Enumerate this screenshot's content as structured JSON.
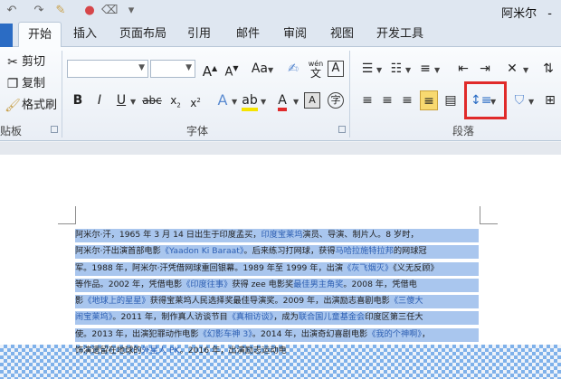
{
  "titlebar": {
    "owner": "阿米尔",
    "minimize": "-"
  },
  "tabs": [
    {
      "label": "开始",
      "active": true
    },
    {
      "label": "插入"
    },
    {
      "label": "页面布局"
    },
    {
      "label": "引用"
    },
    {
      "label": "邮件"
    },
    {
      "label": "审阅"
    },
    {
      "label": "视图"
    },
    {
      "label": "开发工具"
    }
  ],
  "clipboard": {
    "cut": "剪切",
    "copy": "复制",
    "format_painter": "格式刷",
    "group_label": "贴板"
  },
  "font": {
    "font_name": "",
    "font_size": "",
    "group_label": "字体",
    "pinyin_label": "wén"
  },
  "paragraph": {
    "group_label": "段落"
  },
  "document": {
    "lines": [
      {
        "segments": [
          {
            "t": "阿米尔·汗，1965 年 3 月 14 日出生于印度孟买，"
          },
          {
            "t": "印度宝莱坞",
            "link": true
          },
          {
            "t": "演员、导演、制片人。8 岁时，"
          }
        ]
      },
      {
        "segments": [
          {
            "t": "阿米尔·汗出演首部电影"
          },
          {
            "t": "《Yaadon Ki Baraat》",
            "link": true
          },
          {
            "t": "。后来练习打网球，获得"
          },
          {
            "t": "马哈拉施特拉邦",
            "link": true
          },
          {
            "t": "的网球冠"
          }
        ]
      },
      {
        "segments": [
          {
            "t": "军。1988 年，阿米尔·汗凭借网球重回银幕。1989 年至 1999 年，出演"
          },
          {
            "t": "《灰飞烟灭》",
            "link": true
          },
          {
            "t": "《义无反顾》"
          }
        ]
      },
      {
        "segments": [
          {
            "t": "等作品。2002 年，凭借电影"
          },
          {
            "t": "《印度往事》",
            "link": true
          },
          {
            "t": "获得 zee 电影奖"
          },
          {
            "t": "最佳男主角奖",
            "link": true
          },
          {
            "t": "。2008 年，凭借电"
          }
        ]
      },
      {
        "segments": [
          {
            "t": "影"
          },
          {
            "t": "《地球上的星星》",
            "link": true
          },
          {
            "t": "获得宝莱坞人民选择奖最佳导演奖。2009 年，出演励志喜剧电影"
          },
          {
            "t": "《三傻大",
            "link": true
          }
        ]
      },
      {
        "segments": [
          {
            "t": "闹宝莱坞》",
            "link": true
          },
          {
            "t": "。2011 年，制作真人访谈节目"
          },
          {
            "t": "《真相访谈》",
            "link": true
          },
          {
            "t": "，成为"
          },
          {
            "t": "联合国儿童基金会",
            "link": true
          },
          {
            "t": "印度区第三任大"
          }
        ]
      },
      {
        "segments": [
          {
            "t": "使。2013 年，出演犯罪动作电影"
          },
          {
            "t": "《幻影车神 3》",
            "link": true
          },
          {
            "t": "。2014 年，出演奇幻喜剧电影"
          },
          {
            "t": "《我的个神啊》",
            "link": true
          },
          {
            "t": "，"
          }
        ]
      },
      {
        "segments": [
          {
            "t": "饰演遗留在地球的"
          },
          {
            "t": "外星人 PK",
            "link": true
          },
          {
            "t": "。2016 年，出演励志运动电"
          }
        ]
      }
    ]
  },
  "colors": {
    "accent": "#2b6cc4",
    "selection": "#a9c6ee",
    "highlight_box": "#e02a2a",
    "link": "#2d5fb3"
  }
}
